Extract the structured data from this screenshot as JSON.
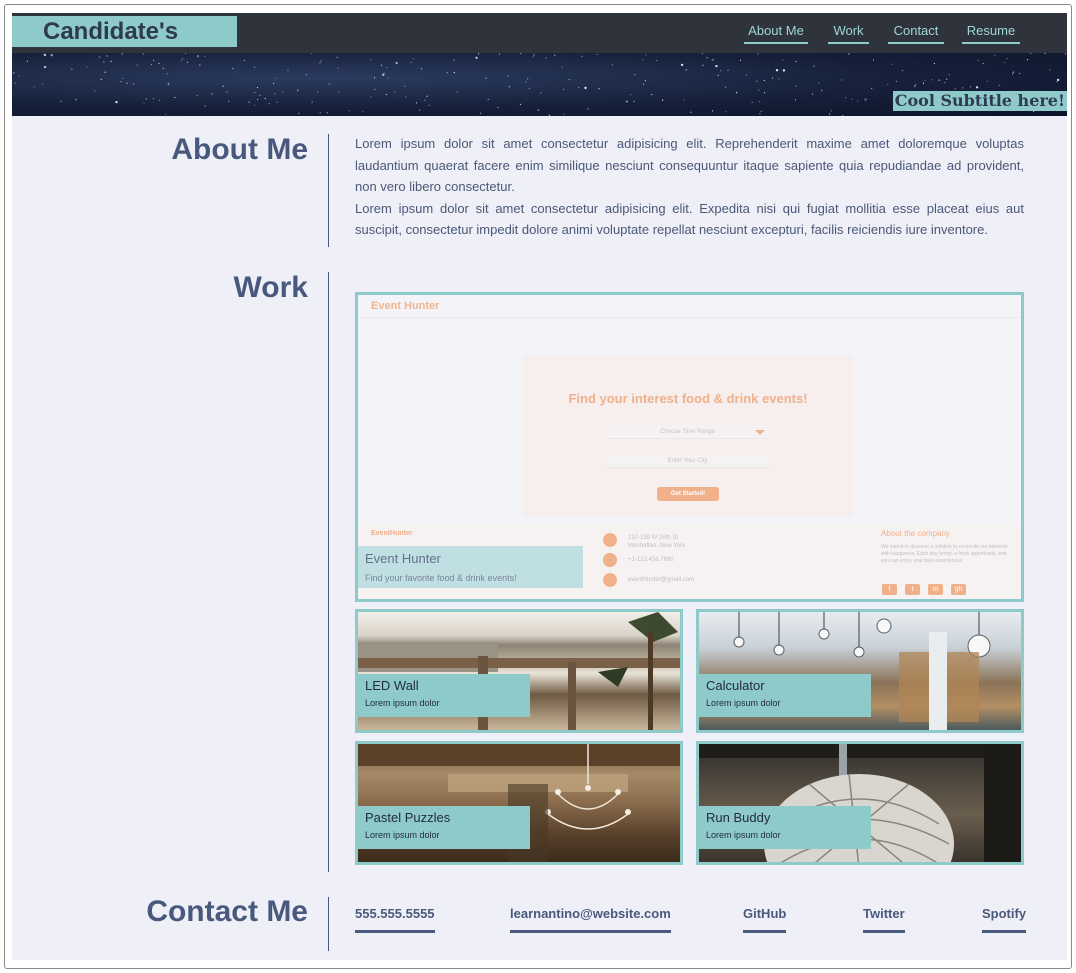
{
  "header": {
    "brand": "Candidate's Name",
    "nav": [
      "About Me",
      "Work",
      "Contact",
      "Resume"
    ],
    "subtitle": "Cool Subtitle here!"
  },
  "about": {
    "title": "About Me",
    "p1": "Lorem ipsum dolor sit amet consectetur adipisicing elit. Reprehenderit maxime amet doloremque voluptas laudantium quaerat facere enim similique nesciunt consequuntur itaque sapiente quia repudiandae ad provident, non vero libero consectetur.",
    "p2": "Lorem ipsum dolor sit amet consectetur adipisicing elit. Expedita nisi qui fugiat mollitia esse placeat eius aut suscipit, consectetur impedit dolore animi voluptate repellat nesciunt excepturi, facilis reiciendis iure inventore."
  },
  "work": {
    "title": "Work",
    "featured": {
      "title": "Event Hunter",
      "description": "Find your favorite food & drink events!",
      "screenshot": {
        "brand": "Event Hunter",
        "headline": "Find your interest food & drink events!",
        "select_placeholder": "Choose Time Range",
        "city_placeholder": "Enter Your City",
        "button": "Get Started!",
        "footer_brand": "EventHunter",
        "address_line1": "137-139 W 26th St",
        "address_line2": "Manhattan, New York",
        "phone": "+1-123.456.7890",
        "email": "eventHunter@gmail.com",
        "about_heading": "About the company",
        "about_text": "We intend to discover a solution to reconcile our interests with happiness. Each day brings a fresh opportunity, and you can enjoy your best experiences.",
        "social": [
          "f",
          "t",
          "in",
          "gh"
        ]
      }
    },
    "projects": [
      {
        "title": "LED Wall",
        "description": "Lorem ipsum dolor"
      },
      {
        "title": "Calculator",
        "description": "Lorem ipsum dolor"
      },
      {
        "title": "Pastel Puzzles",
        "description": "Lorem ipsum dolor"
      },
      {
        "title": "Run Buddy",
        "description": "Lorem ipsum dolor"
      }
    ]
  },
  "contact": {
    "title": "Contact Me",
    "links": [
      "555.555.5555",
      "learnantino@website.com",
      "GitHub",
      "Twitter",
      "Spotify"
    ]
  },
  "colors": {
    "accent": "#8ecac9",
    "text": "#49597d",
    "background": "#eeeff7",
    "navbar": "#2f333c",
    "event_hunter": "#f0b08a"
  }
}
